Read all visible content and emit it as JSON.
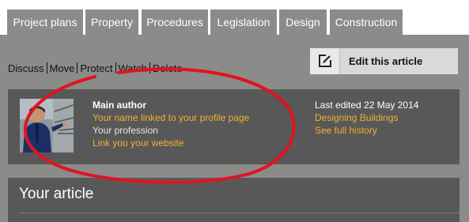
{
  "tabs": [
    {
      "label": "Project plans"
    },
    {
      "label": "Property"
    },
    {
      "label": "Procedures"
    },
    {
      "label": "Legislation"
    },
    {
      "label": "Design"
    },
    {
      "label": "Construction"
    }
  ],
  "article_actions": [
    "Discuss",
    "Move",
    "Protect",
    "Watch",
    "Delete"
  ],
  "edit_button": {
    "label": "Edit this article",
    "icon": "edit-note-icon"
  },
  "author": {
    "heading": "Main author",
    "name_link": "Your name linked to your profile page",
    "profession": "Your profession",
    "website_link": "Link you your website"
  },
  "edit_info": {
    "last_edited": "Last edited 22 May 2014",
    "editor_link": "Designing Buildings",
    "history_link": "See full history"
  },
  "article": {
    "title": "Your article"
  },
  "colors": {
    "link": "#f0b030",
    "panel": "#585858",
    "page_background": "#8b8b8a",
    "annotation": "#e0141e"
  }
}
